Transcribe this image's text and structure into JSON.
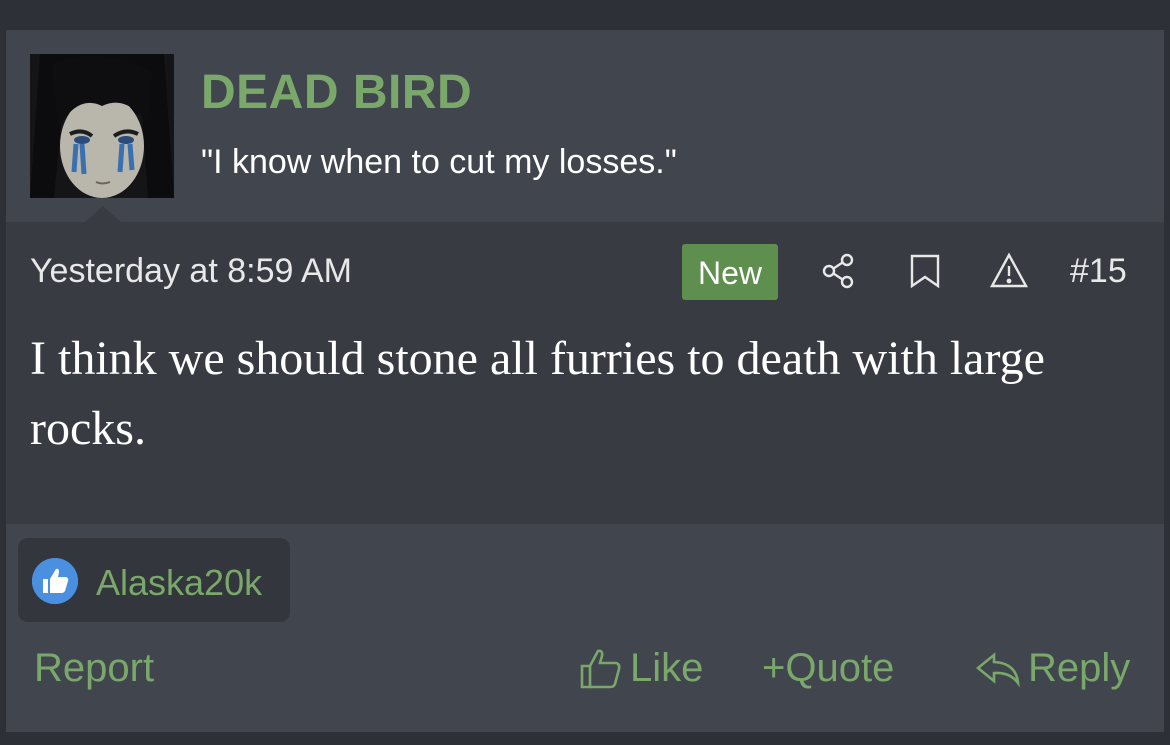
{
  "user": {
    "name": "DEAD BIRD",
    "title": "\"I know when to cut my losses.\""
  },
  "post": {
    "timestamp": "Yesterday at 8:59 AM",
    "badge": "New",
    "number": "#15",
    "message": "I think we should stone all furries to death with large rocks."
  },
  "reactions": {
    "icon": "thumbs-up-icon",
    "user": "Alaska20k"
  },
  "actions": {
    "report": "Report",
    "like": "Like",
    "quote": "Quote",
    "quote_prefix": "+",
    "reply": "Reply"
  },
  "colors": {
    "accent_green": "#7aa86a",
    "badge_green": "#5f8f4e",
    "post_bg": "#41454d",
    "body_bg": "#383b42"
  }
}
